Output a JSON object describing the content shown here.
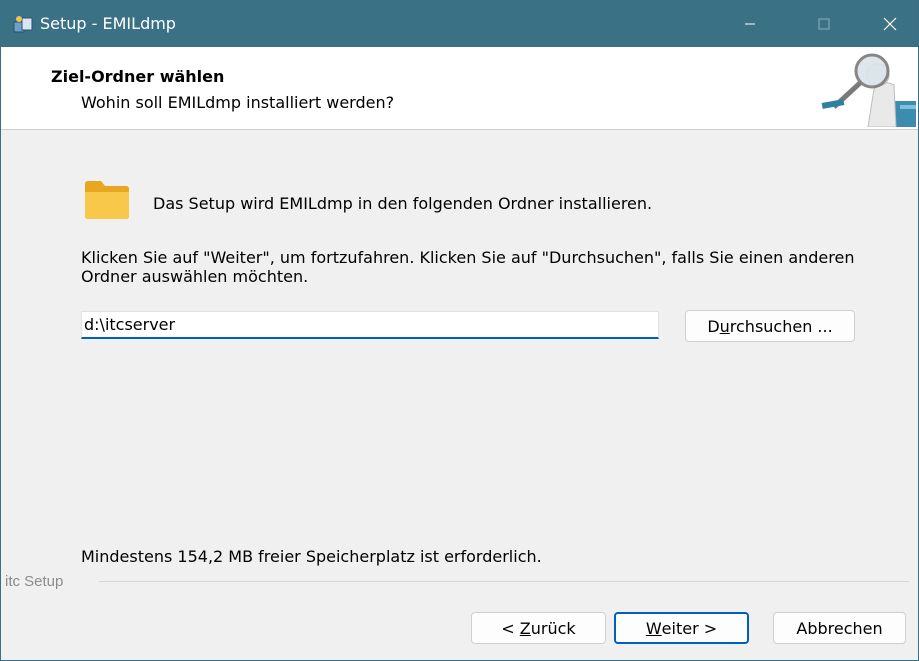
{
  "window": {
    "title": "Setup - EMILdmp"
  },
  "titlebar": {
    "icons": [
      "app-setup-icon",
      "minimize-icon",
      "maximize-icon",
      "close-icon"
    ]
  },
  "header": {
    "title": "Ziel-Ordner wählen",
    "subtitle": "Wohin soll EMILdmp installiert werden?",
    "image": "magnifier-wizard-image"
  },
  "content": {
    "info_text": "Das Setup wird EMILdmp in den folgenden Ordner installieren.",
    "instruction_text": "Klicken Sie auf \"Weiter\", um fortzufahren. Klicken Sie auf \"Durchsuchen\", falls Sie einen anderen Ordner auswählen möchten.",
    "path_value": "d:\\itcserver",
    "browse_label_pre": "D",
    "browse_label_accel": "u",
    "browse_label_post": "rchsuchen ...",
    "space_text": "Mindestens 154,2 MB freier Speicherplatz ist erforderlich."
  },
  "footer": {
    "group_label": "itc Setup",
    "back_pre": "< ",
    "back_accel": "Z",
    "back_post": "urück",
    "next_accel": "W",
    "next_post": "eiter >",
    "cancel_label": "Abbrechen"
  },
  "colors": {
    "titlebar": "#3b7185",
    "accent": "#005fb8",
    "folder": "#f8c84a"
  }
}
